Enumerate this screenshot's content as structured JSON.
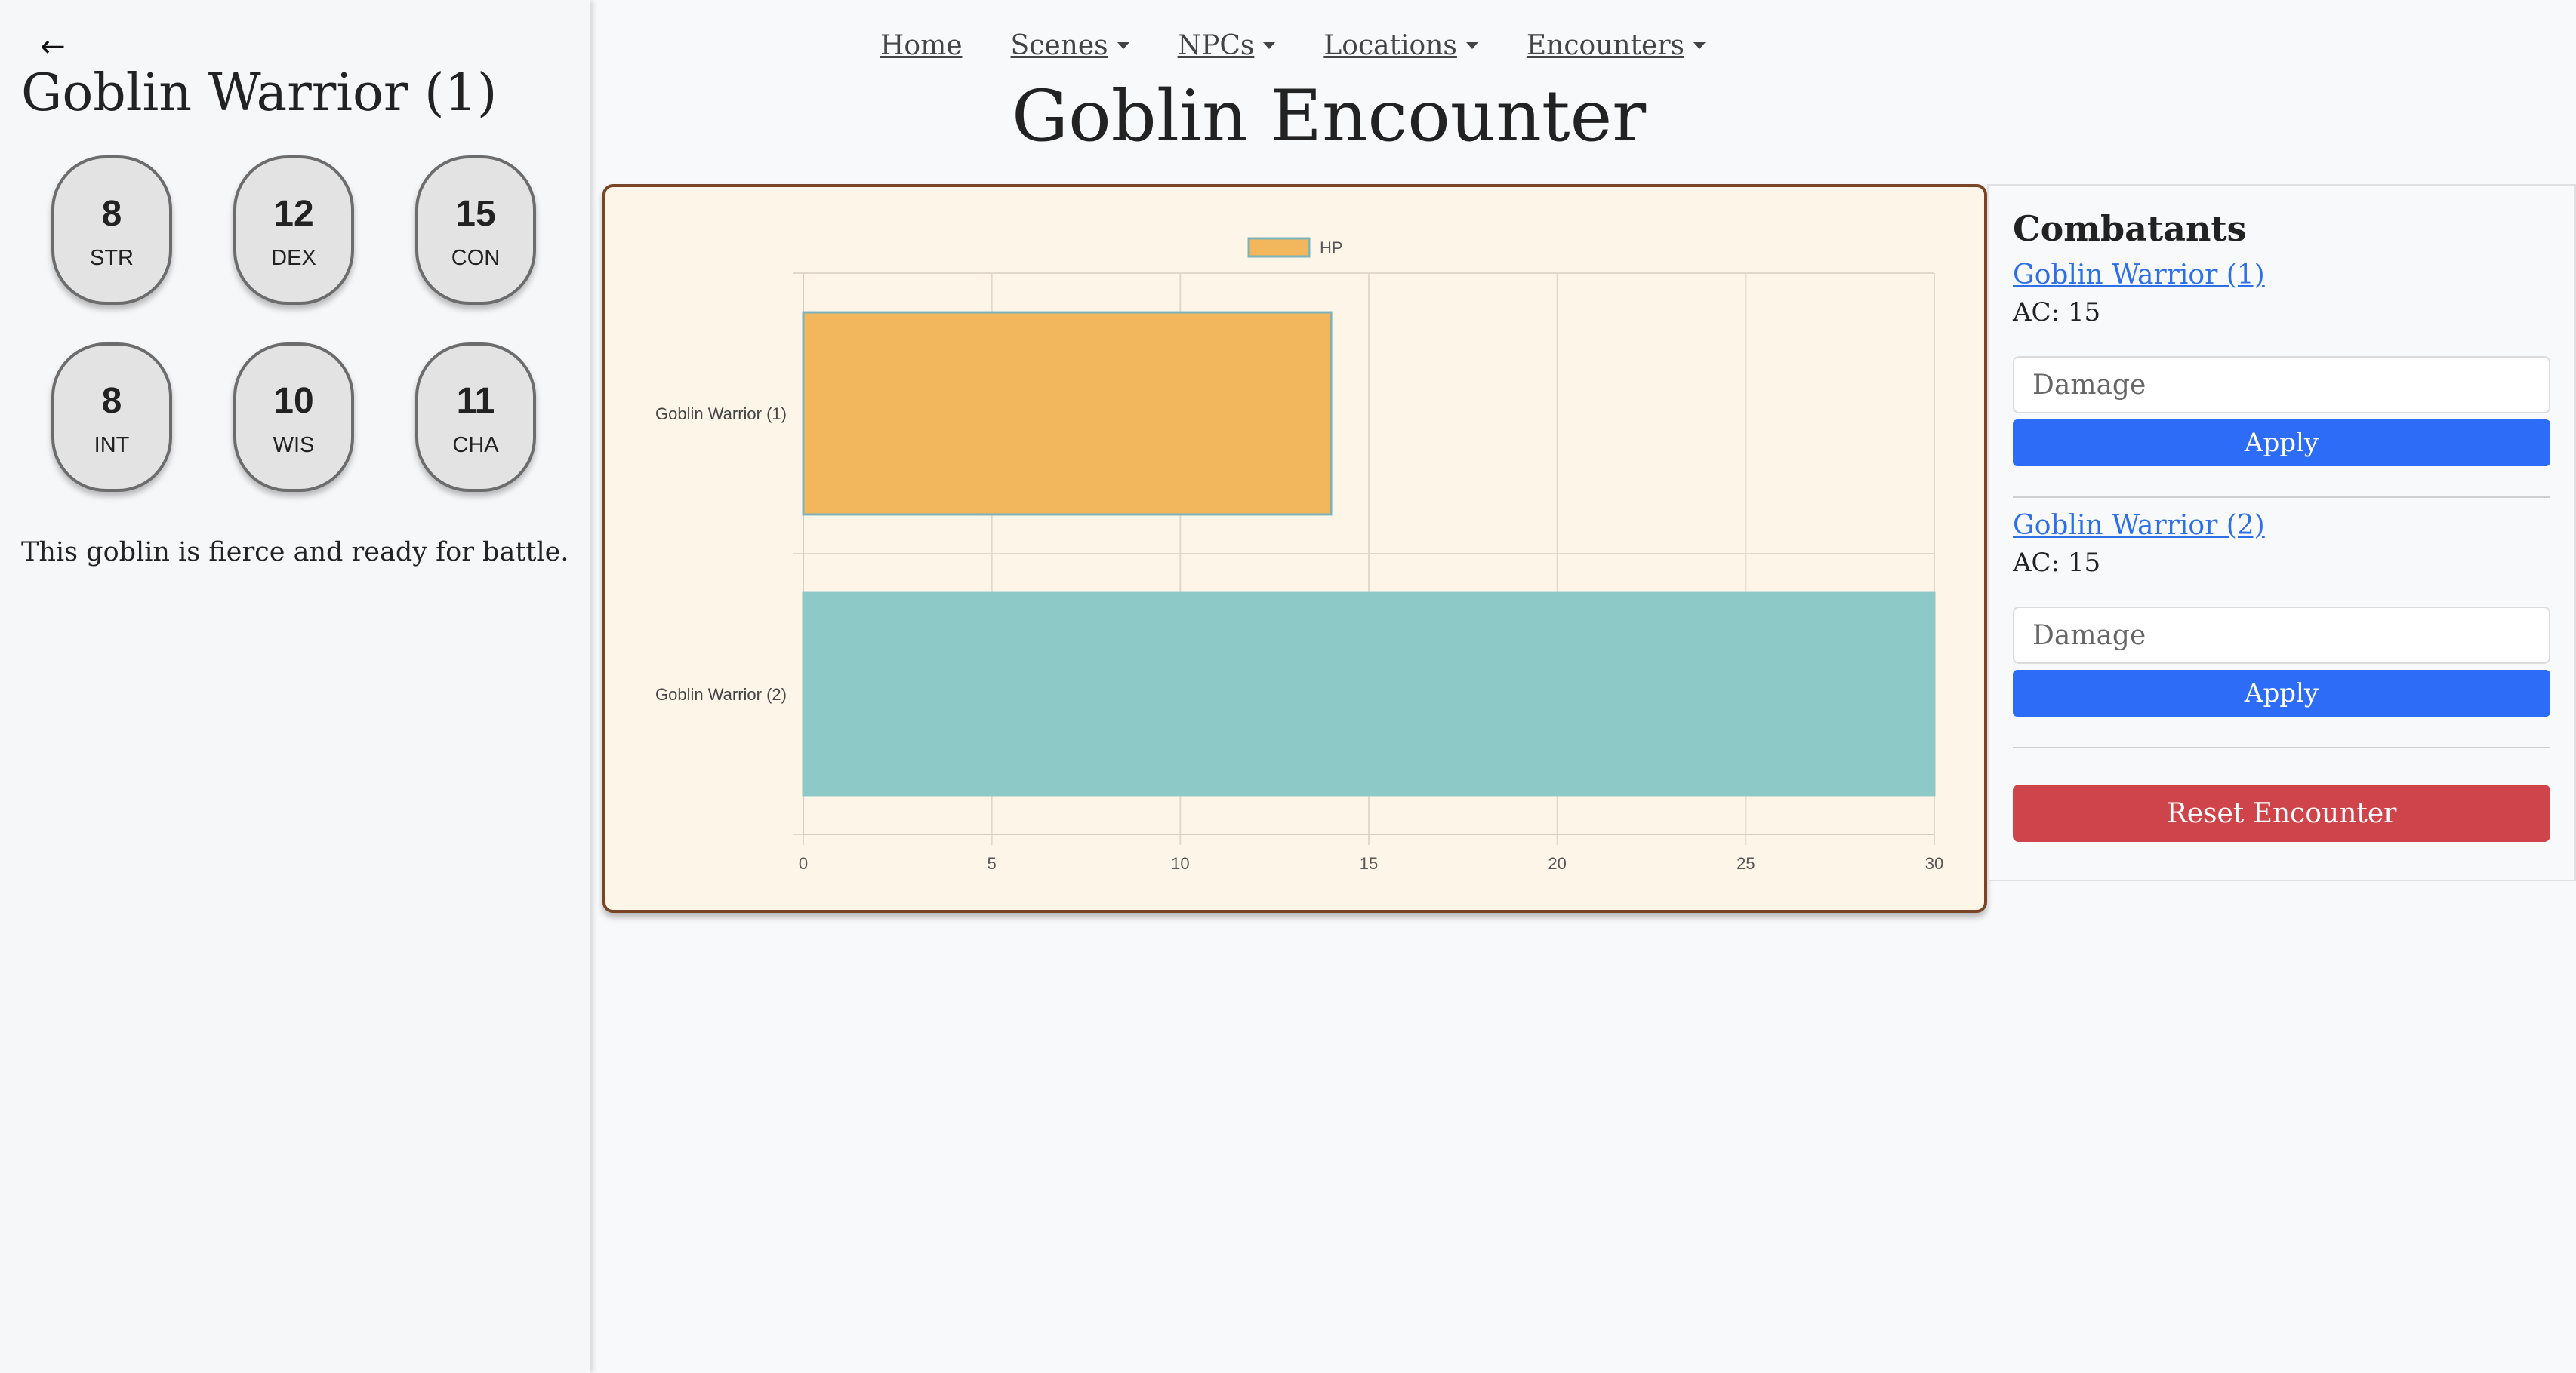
{
  "sidebar": {
    "back_icon": "arrow-left-icon",
    "npc_name": "Goblin Warrior (1)",
    "stats": [
      {
        "value": "8",
        "label": "STR"
      },
      {
        "value": "12",
        "label": "DEX"
      },
      {
        "value": "15",
        "label": "CON"
      },
      {
        "value": "8",
        "label": "INT"
      },
      {
        "value": "10",
        "label": "WIS"
      },
      {
        "value": "11",
        "label": "CHA"
      }
    ],
    "description": "This goblin is fierce and ready for battle."
  },
  "nav": {
    "items": [
      {
        "label": "Home",
        "dropdown": false
      },
      {
        "label": "Scenes",
        "dropdown": true
      },
      {
        "label": "NPCs",
        "dropdown": true
      },
      {
        "label": "Locations",
        "dropdown": true
      },
      {
        "label": "Encounters",
        "dropdown": true
      }
    ]
  },
  "page": {
    "title": "Goblin Encounter"
  },
  "chart_data": {
    "type": "bar",
    "orientation": "horizontal",
    "categories": [
      "Goblin Warrior (1)",
      "Goblin Warrior (2)"
    ],
    "series": [
      {
        "name": "HP",
        "values": [
          14,
          30
        ]
      }
    ],
    "bar_colors": [
      "#f2b75c",
      "#8cc9c7"
    ],
    "bar_border_colors": [
      "#7fb3ba",
      "#8cc9c7"
    ],
    "xlim": [
      0,
      30
    ],
    "xticks": [
      "0",
      "5",
      "10",
      "15",
      "20",
      "25",
      "30"
    ],
    "legend": "top",
    "grid": true
  },
  "combatants": {
    "title": "Combatants",
    "items": [
      {
        "name": "Goblin Warrior (1)",
        "ac": "AC: 15",
        "damage_placeholder": "Damage",
        "damage_value": "",
        "apply_label": "Apply"
      },
      {
        "name": "Goblin Warrior (2)",
        "ac": "AC: 15",
        "damage_placeholder": "Damage",
        "damage_value": "",
        "apply_label": "Apply"
      }
    ],
    "reset_label": "Reset Encounter"
  },
  "colors": {
    "link": "#2d6fe8",
    "apply": "#2c6cf6",
    "reset": "#cf444b",
    "panel_bg": "#fdf5e8",
    "panel_border": "#7a4526"
  }
}
